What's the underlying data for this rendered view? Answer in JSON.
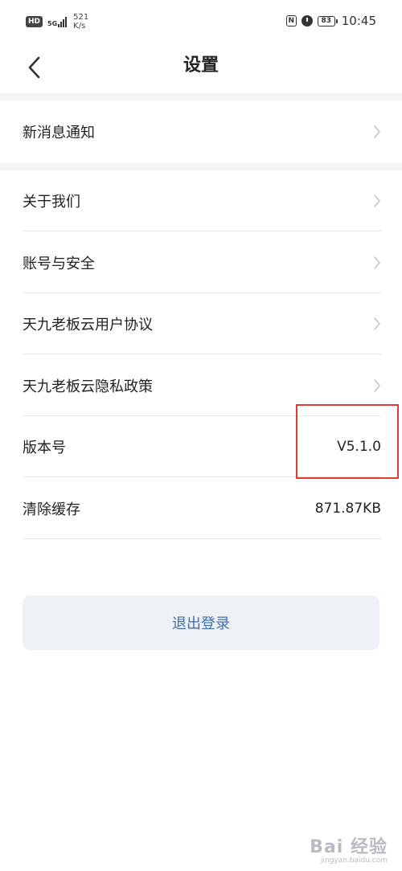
{
  "status_bar": {
    "hd_badge": "HD",
    "network_type": "5G",
    "speed_value": "521",
    "speed_unit": "K/s",
    "battery_level": "83",
    "time": "10:45"
  },
  "nav": {
    "title": "设置",
    "back_icon": "chevron-left-icon"
  },
  "section1": {
    "items": [
      {
        "label": "新消息通知",
        "chevron": true
      }
    ]
  },
  "section2": {
    "items": [
      {
        "label": "关于我们",
        "chevron": true
      },
      {
        "label": "账号与安全",
        "chevron": true
      },
      {
        "label": "天九老板云用户协议",
        "chevron": true
      },
      {
        "label": "天九老板云隐私政策",
        "chevron": true
      },
      {
        "label": "版本号",
        "value": "V5.1.0"
      },
      {
        "label": "清除缓存",
        "value": "871.87KB"
      }
    ]
  },
  "logout_label": "退出登录",
  "annotation_color": "#e03a3a",
  "accent_color": "#3f6fb3",
  "watermark": {
    "logo": "Bai 经验",
    "url": "jingyan.baidu.com"
  }
}
